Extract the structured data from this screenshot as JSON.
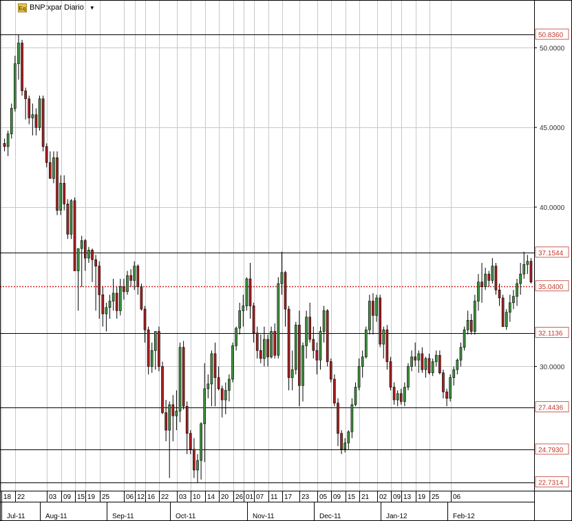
{
  "header": {
    "symbol_label": "BNP:xpar Diario",
    "icon": "eq-icon"
  },
  "colors": {
    "up": "#3f8f3f",
    "down": "#a82020",
    "level_line": "#000000",
    "last_price_line": "#d42020",
    "level_label": "#c0392b",
    "grid": "#c8c8c8"
  },
  "chart_data": {
    "type": "candlestick",
    "title": "BNP:xpar Diario",
    "ylim": [
      22.2,
      53.0
    ],
    "y_ticks": [
      "30.0000",
      "40.0000",
      "45.0000",
      "50.0000"
    ],
    "y_tick_values": [
      30,
      40,
      45,
      50
    ],
    "price_levels": [
      {
        "value": 50.836,
        "label": "50.8360"
      },
      {
        "value": 37.1544,
        "label": "37.1544"
      },
      {
        "value": 32.1136,
        "label": "32.1136"
      },
      {
        "value": 27.4436,
        "label": "27.4436"
      },
      {
        "value": 24.793,
        "label": "24.7930"
      },
      {
        "value": 22.7314,
        "label": "22.7314"
      }
    ],
    "last_price": {
      "value": 35.04,
      "label": "35.0400"
    },
    "day_labels": [
      "18",
      "22",
      "03",
      "09",
      "15",
      "19",
      "25",
      "06",
      "12",
      "16",
      "22",
      "03",
      "10",
      "14",
      "20",
      "26",
      "01",
      "07",
      "11",
      "17",
      "23",
      "05",
      "09",
      "15",
      "21",
      "02",
      "09",
      "13",
      "19",
      "25",
      "06"
    ],
    "month_labels": [
      "Jul-11",
      "Aug-11",
      "Sep-11",
      "Oct-11",
      "Nov-11",
      "Dec-11",
      "Jan-12",
      "Feb-12"
    ],
    "candles": [
      [
        44.0,
        44.3,
        43.5,
        43.8
      ],
      [
        43.8,
        44.8,
        43.2,
        44.6
      ],
      [
        44.6,
        46.5,
        44.3,
        46.2
      ],
      [
        46.2,
        49.5,
        46.0,
        49.0
      ],
      [
        49.0,
        50.8,
        48.0,
        50.3
      ],
      [
        50.3,
        50.5,
        47.0,
        47.3
      ],
      [
        47.3,
        47.5,
        45.5,
        46.8
      ],
      [
        46.8,
        47.0,
        45.2,
        45.6
      ],
      [
        45.6,
        46.5,
        44.5,
        45.8
      ],
      [
        45.8,
        46.2,
        44.5,
        45.0
      ],
      [
        45.0,
        47.0,
        44.8,
        46.8
      ],
      [
        46.8,
        47.0,
        43.5,
        43.8
      ],
      [
        43.8,
        44.0,
        42.5,
        42.8
      ],
      [
        42.8,
        43.5,
        41.8,
        41.8
      ],
      [
        41.8,
        43.5,
        41.5,
        43.1
      ],
      [
        43.1,
        43.5,
        39.5,
        39.8
      ],
      [
        39.8,
        42.0,
        39.5,
        41.5
      ],
      [
        41.5,
        42.0,
        39.8,
        40.2
      ],
      [
        40.2,
        40.5,
        38.0,
        38.3
      ],
      [
        38.3,
        40.5,
        38.0,
        40.4
      ],
      [
        40.4,
        40.6,
        36.0,
        36.0
      ],
      [
        36.0,
        36.5,
        33.5,
        37.4
      ],
      [
        37.4,
        38.2,
        35.0,
        37.9
      ],
      [
        37.9,
        38.0,
        36.0,
        36.8
      ],
      [
        36.8,
        37.5,
        36.5,
        37.3
      ],
      [
        37.3,
        37.4,
        35.3,
        36.7
      ],
      [
        36.7,
        37.0,
        33.5,
        36.3
      ],
      [
        36.3,
        36.6,
        33.0,
        34.5
      ],
      [
        34.5,
        35.0,
        32.5,
        33.3
      ],
      [
        33.3,
        34.0,
        32.2,
        33.7
      ],
      [
        33.7,
        34.5,
        33.0,
        34.1
      ],
      [
        34.1,
        35.5,
        33.5,
        34.6
      ],
      [
        34.6,
        35.0,
        33.0,
        33.5
      ],
      [
        33.5,
        35.5,
        33.2,
        35.0
      ],
      [
        35.0,
        35.5,
        34.2,
        34.7
      ],
      [
        34.7,
        36.0,
        34.5,
        35.7
      ],
      [
        35.7,
        36.1,
        35.0,
        35.4
      ],
      [
        35.4,
        36.6,
        34.8,
        36.3
      ],
      [
        36.3,
        36.4,
        34.5,
        35.0
      ],
      [
        35.0,
        35.2,
        33.5,
        33.6
      ],
      [
        33.6,
        33.8,
        31.5,
        32.3
      ],
      [
        32.3,
        32.5,
        29.5,
        30.0
      ],
      [
        30.0,
        31.5,
        29.6,
        31.0
      ],
      [
        31.0,
        31.6,
        29.8,
        32.2
      ],
      [
        32.2,
        32.5,
        29.7,
        30.0
      ],
      [
        30.0,
        30.3,
        27.0,
        27.1
      ],
      [
        27.1,
        27.9,
        25.3,
        26.0
      ],
      [
        26.0,
        27.8,
        23.0,
        27.6
      ],
      [
        27.6,
        28.2,
        25.3,
        26.9
      ],
      [
        26.9,
        28.5,
        26.0,
        27.2
      ],
      [
        27.2,
        31.5,
        26.5,
        31.2
      ],
      [
        31.2,
        31.6,
        27.3,
        27.5
      ],
      [
        27.5,
        27.8,
        24.5,
        25.8
      ],
      [
        25.8,
        26.0,
        24.5,
        24.8
      ],
      [
        24.8,
        25.5,
        23.0,
        23.5
      ],
      [
        23.5,
        24.5,
        22.7,
        24.1
      ],
      [
        24.1,
        26.5,
        22.9,
        26.4
      ],
      [
        26.4,
        30.2,
        24.0,
        28.6
      ],
      [
        28.6,
        29.5,
        28.0,
        28.9
      ],
      [
        28.9,
        31.0,
        27.5,
        30.8
      ],
      [
        30.8,
        31.5,
        27.5,
        29.3
      ],
      [
        29.3,
        30.0,
        28.5,
        28.6
      ],
      [
        28.6,
        28.8,
        26.8,
        27.9
      ],
      [
        27.9,
        29.0,
        27.0,
        28.5
      ],
      [
        28.5,
        29.5,
        27.8,
        29.2
      ],
      [
        29.2,
        31.5,
        29.0,
        31.3
      ],
      [
        31.3,
        32.5,
        31.0,
        32.4
      ],
      [
        32.4,
        34.0,
        32.0,
        33.5
      ],
      [
        33.5,
        34.5,
        32.5,
        33.8
      ],
      [
        33.8,
        35.6,
        33.5,
        35.5
      ],
      [
        35.5,
        36.5,
        33.0,
        33.8
      ],
      [
        33.8,
        34.0,
        31.5,
        32.1
      ],
      [
        32.1,
        32.5,
        30.5,
        31.0
      ],
      [
        31.0,
        32.0,
        30.2,
        30.5
      ],
      [
        30.5,
        32.5,
        30.0,
        31.7
      ],
      [
        31.7,
        32.0,
        30.0,
        30.6
      ],
      [
        30.6,
        32.5,
        30.5,
        32.2
      ],
      [
        32.2,
        32.7,
        30.5,
        30.7
      ],
      [
        30.7,
        35.6,
        30.5,
        35.2
      ],
      [
        35.2,
        37.2,
        34.5,
        35.9
      ],
      [
        35.9,
        36.0,
        32.5,
        33.6
      ],
      [
        33.6,
        33.8,
        28.5,
        29.3
      ],
      [
        29.3,
        31.0,
        28.5,
        29.8
      ],
      [
        29.8,
        32.8,
        29.5,
        32.6
      ],
      [
        32.6,
        33.5,
        27.5,
        28.8
      ],
      [
        28.8,
        31.5,
        27.8,
        31.3
      ],
      [
        31.3,
        33.5,
        30.5,
        33.1
      ],
      [
        33.1,
        34.0,
        31.5,
        31.7
      ],
      [
        31.7,
        32.5,
        30.5,
        31.0
      ],
      [
        31.0,
        31.5,
        29.5,
        30.4
      ],
      [
        30.4,
        32.5,
        29.8,
        32.2
      ],
      [
        32.2,
        33.8,
        31.5,
        33.5
      ],
      [
        33.5,
        33.6,
        30.0,
        30.3
      ],
      [
        30.3,
        30.5,
        29.0,
        29.2
      ],
      [
        29.2,
        29.5,
        27.5,
        27.7
      ],
      [
        27.7,
        28.0,
        25.0,
        25.8
      ],
      [
        25.8,
        26.0,
        24.5,
        24.8
      ],
      [
        24.8,
        25.5,
        24.6,
        25.2
      ],
      [
        25.2,
        26.0,
        24.8,
        25.9
      ],
      [
        25.9,
        28.0,
        25.5,
        27.6
      ],
      [
        27.6,
        29.0,
        27.5,
        28.7
      ],
      [
        28.7,
        30.5,
        28.5,
        30.0
      ],
      [
        30.0,
        31.0,
        29.3,
        30.6
      ],
      [
        30.6,
        32.5,
        30.5,
        32.3
      ],
      [
        32.3,
        34.5,
        32.0,
        34.1
      ],
      [
        34.1,
        34.6,
        32.0,
        33.2
      ],
      [
        33.2,
        34.5,
        32.8,
        34.3
      ],
      [
        34.3,
        34.5,
        31.2,
        31.4
      ],
      [
        31.4,
        32.5,
        30.5,
        32.3
      ],
      [
        32.3,
        32.6,
        29.8,
        30.3
      ],
      [
        30.3,
        30.6,
        28.5,
        28.7
      ],
      [
        28.7,
        29.0,
        27.6,
        27.9
      ],
      [
        27.9,
        28.5,
        27.5,
        28.3
      ],
      [
        28.3,
        28.6,
        27.6,
        27.8
      ],
      [
        27.8,
        29.0,
        27.5,
        28.7
      ],
      [
        28.7,
        30.2,
        28.5,
        30.0
      ],
      [
        30.0,
        31.0,
        29.7,
        30.6
      ],
      [
        30.6,
        31.5,
        30.0,
        30.4
      ],
      [
        30.4,
        31.0,
        29.6,
        30.8
      ],
      [
        30.8,
        31.2,
        29.6,
        29.8
      ],
      [
        29.8,
        30.6,
        29.3,
        30.5
      ],
      [
        30.5,
        30.8,
        29.5,
        29.6
      ],
      [
        29.6,
        30.5,
        29.4,
        30.3
      ],
      [
        30.3,
        31.0,
        30.0,
        30.7
      ],
      [
        30.7,
        31.0,
        29.5,
        29.6
      ],
      [
        29.6,
        29.8,
        28.0,
        28.4
      ],
      [
        28.4,
        28.6,
        27.5,
        28.0
      ],
      [
        28.0,
        29.5,
        27.8,
        29.3
      ],
      [
        29.3,
        30.0,
        28.8,
        29.8
      ],
      [
        29.8,
        30.5,
        29.5,
        30.4
      ],
      [
        30.4,
        31.5,
        30.0,
        31.2
      ],
      [
        31.2,
        32.5,
        31.0,
        32.3
      ],
      [
        32.3,
        33.5,
        32.0,
        32.9
      ],
      [
        32.9,
        33.3,
        32.0,
        32.2
      ],
      [
        32.2,
        34.5,
        32.0,
        34.1
      ],
      [
        34.1,
        35.8,
        33.5,
        35.3
      ],
      [
        35.3,
        36.5,
        34.0,
        35.0
      ],
      [
        35.0,
        36.2,
        34.8,
        35.8
      ],
      [
        35.8,
        36.0,
        35.0,
        35.4
      ],
      [
        35.4,
        36.8,
        35.2,
        36.3
      ],
      [
        36.3,
        36.5,
        34.5,
        34.8
      ],
      [
        34.8,
        35.2,
        33.8,
        34.3
      ],
      [
        34.3,
        34.5,
        32.5,
        32.5
      ],
      [
        32.5,
        33.6,
        32.3,
        33.4
      ],
      [
        33.4,
        34.5,
        32.8,
        34.0
      ],
      [
        34.0,
        34.8,
        33.6,
        34.4
      ],
      [
        34.4,
        35.5,
        33.8,
        35.2
      ],
      [
        35.2,
        36.5,
        34.5,
        35.8
      ],
      [
        35.8,
        37.2,
        35.5,
        36.4
      ],
      [
        36.4,
        37.0,
        35.8,
        36.6
      ],
      [
        36.6,
        36.8,
        35.2,
        35.3
      ]
    ]
  }
}
